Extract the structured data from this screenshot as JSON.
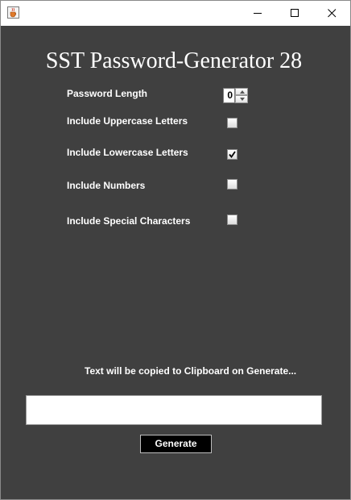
{
  "window": {
    "app_icon": "java-cup-icon",
    "controls": [
      "minimize-icon",
      "maximize-icon",
      "close-icon"
    ]
  },
  "title": "SST Password-Generator 28",
  "options": {
    "password_length": {
      "label": "Password Length",
      "value": "0"
    },
    "uppercase": {
      "label": "Include Uppercase Letters",
      "checked": false
    },
    "lowercase": {
      "label": "Include Lowercase Letters",
      "checked": true
    },
    "numbers": {
      "label": "Include Numbers",
      "checked": false
    },
    "special": {
      "label": "Include Special Characters",
      "checked": false
    }
  },
  "clipboard_note": "Text will be copied to Clipboard on Generate...",
  "output": {
    "value": ""
  },
  "generate_label": "Generate"
}
